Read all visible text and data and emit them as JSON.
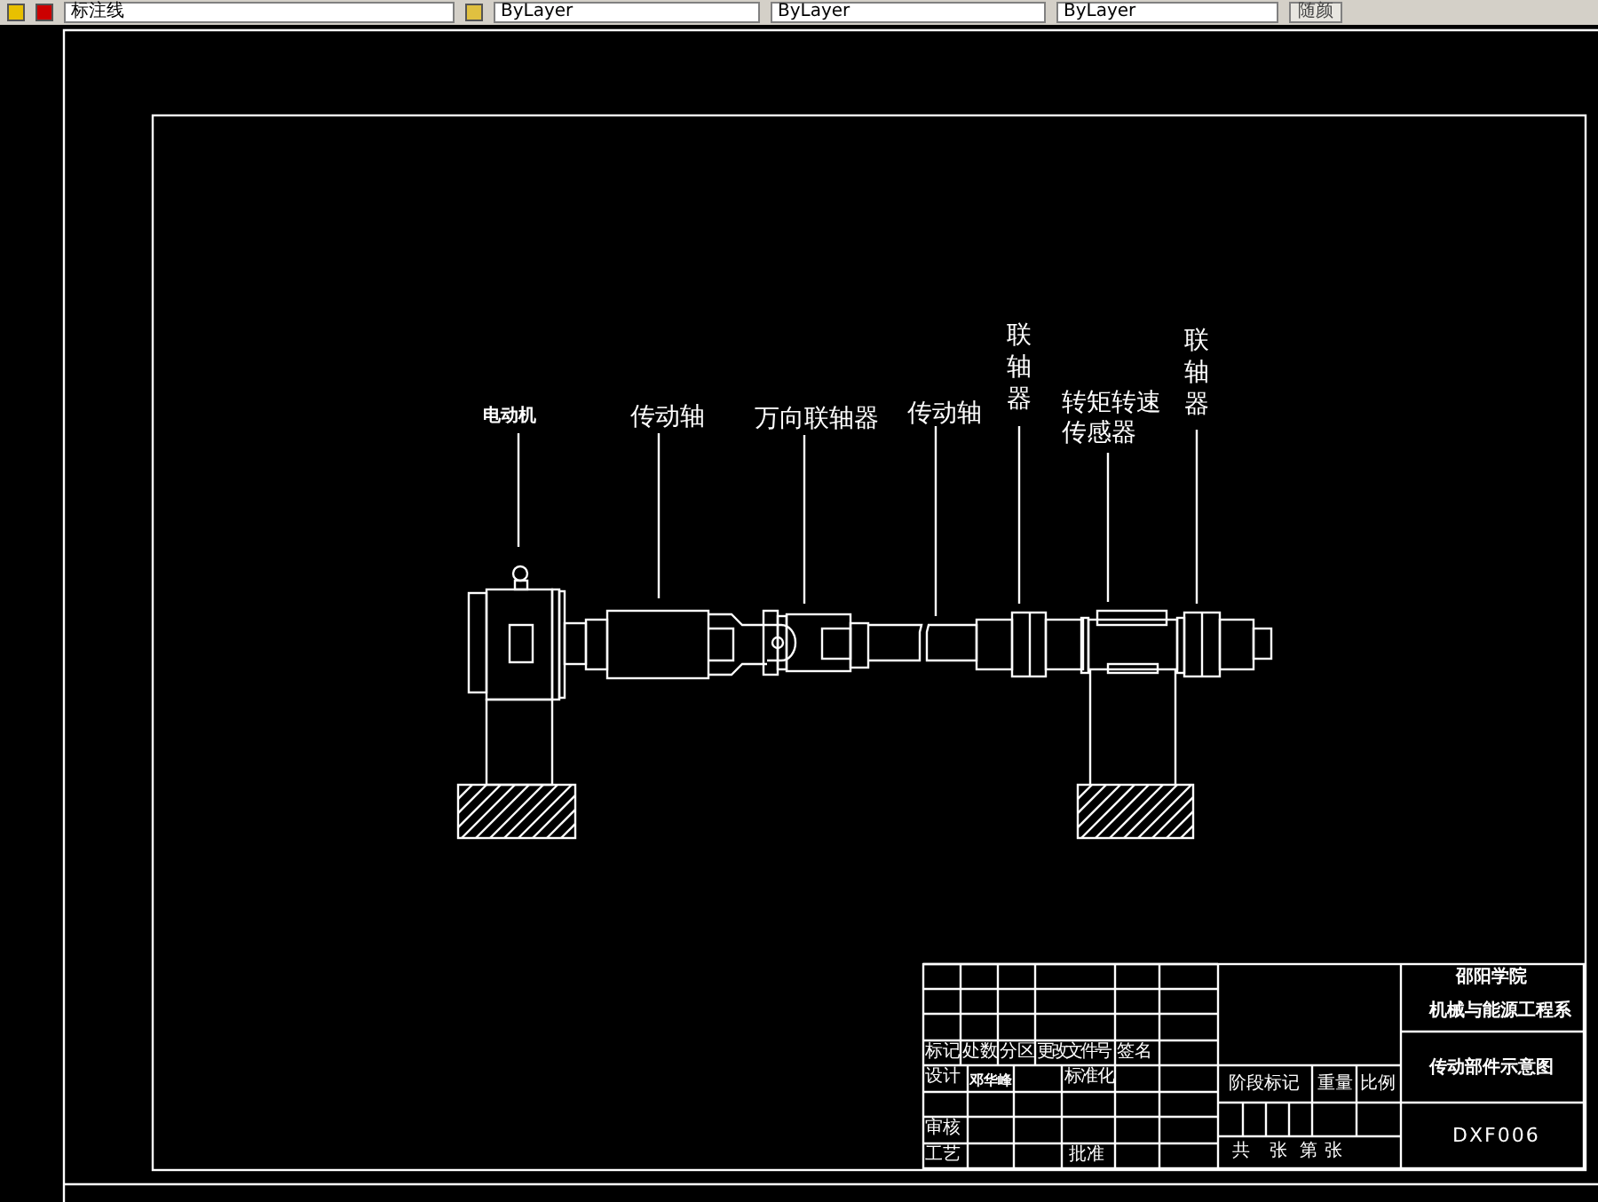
{
  "toolbar": {
    "layer": "标注线",
    "color_field": "ByLayer",
    "linetype": "ByLayer",
    "lineweight": "ByLayer",
    "plot_style": "随颜"
  },
  "drawing": {
    "labels": [
      {
        "text": "电动机",
        "kind": "small"
      },
      {
        "text": "传动轴",
        "kind": "horizontal"
      },
      {
        "text": "万向联轴器",
        "kind": "horizontal"
      },
      {
        "text": "传动轴",
        "kind": "horizontal"
      },
      {
        "text": "联轴器",
        "kind": "vertical"
      },
      {
        "text": "转矩转速传感器",
        "kind": "wrapped"
      },
      {
        "text": "联轴器",
        "kind": "vertical"
      }
    ]
  },
  "title_block": {
    "headers": [
      "标记",
      "处数",
      "分区",
      "更改文件号",
      "签名"
    ],
    "designer_label": "设计",
    "designer_name": "邓华峰",
    "standardization": "标准化",
    "reviewer": "审核",
    "process": "工艺",
    "approval": "批准",
    "stage_mark": "阶段标记",
    "weight": "重量",
    "scale": "比例",
    "sheets": [
      "共",
      "张",
      "第",
      "张"
    ],
    "school": "邵阳学院",
    "department": "机械与能源工程系",
    "drawing_title": "传动部件示意图",
    "drawing_number": "DXF006"
  }
}
